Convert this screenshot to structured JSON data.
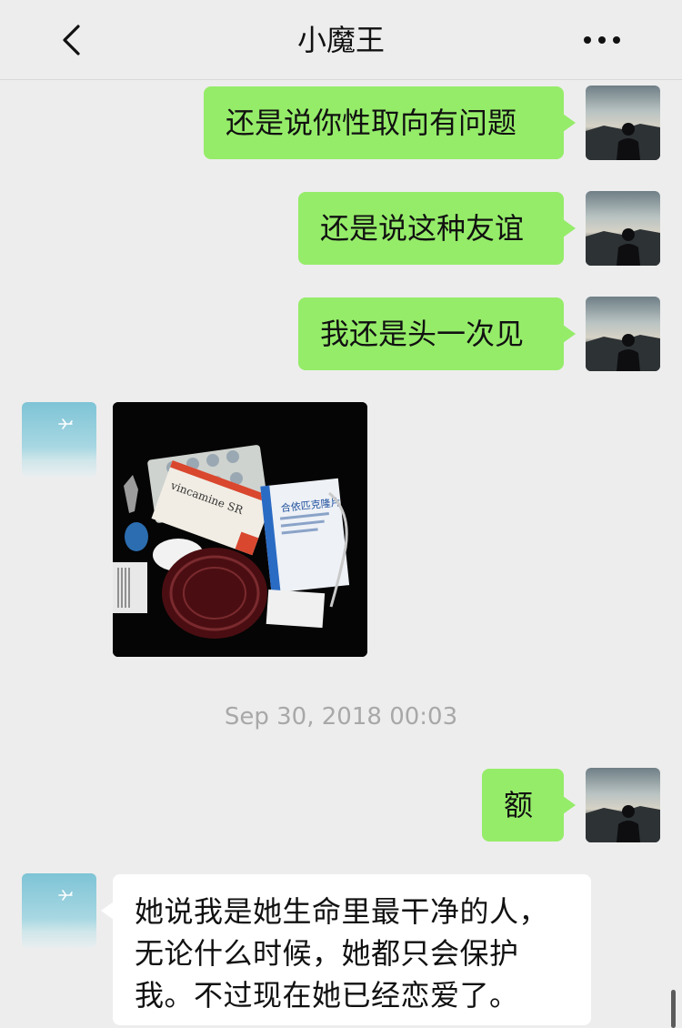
{
  "header": {
    "title": "小魔王",
    "back_icon": "chevron-left-icon",
    "more_icon": "more-dots-icon"
  },
  "messages": [
    {
      "side": "sent",
      "text": "还是说你性取向有问题"
    },
    {
      "side": "sent",
      "text": "还是说这种友谊"
    },
    {
      "side": "sent",
      "text": "我还是头一次见"
    },
    {
      "side": "recv",
      "type": "image",
      "image_text": {
        "product": "vincamine SR",
        "box_label": "合依匹克隆片"
      }
    },
    {
      "side": "sent",
      "text": "额"
    },
    {
      "side": "recv",
      "text": "她说我是她生命里最干净的人，无论什么时候，她都只会保护我。不过现在她已经恋爱了。"
    }
  ],
  "timestamp": "Sep 30, 2018 00:03",
  "colors": {
    "background": "#ededed",
    "sent_bubble": "#95ec69",
    "recv_bubble": "#ffffff",
    "timestamp": "#a8a8a8"
  }
}
